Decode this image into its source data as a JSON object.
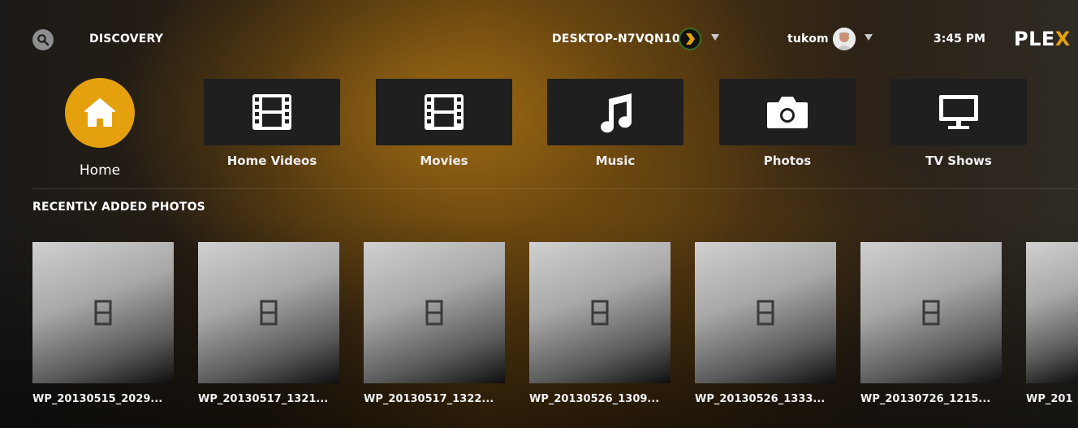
{
  "header": {
    "discovery_label": "DISCOVERY",
    "server_name": "DESKTOP-N7VQN10",
    "username": "tukom",
    "time": "3:45 PM",
    "logo_text": "PLE",
    "logo_accent": "X"
  },
  "nav": {
    "home_label": "Home",
    "libraries": [
      {
        "label": "Home Videos",
        "icon": "film-icon"
      },
      {
        "label": "Movies",
        "icon": "film-icon"
      },
      {
        "label": "Music",
        "icon": "music-note-icon"
      },
      {
        "label": "Photos",
        "icon": "camera-icon"
      },
      {
        "label": "TV Shows",
        "icon": "tv-icon"
      }
    ]
  },
  "recent": {
    "title": "RECENTLY ADDED PHOTOS",
    "items": [
      "WP_20130515_2029...",
      "WP_20130517_1321...",
      "WP_20130517_1322...",
      "WP_20130526_1309...",
      "WP_20130526_1333...",
      "WP_20130726_1215...",
      "WP_201"
    ]
  },
  "colors": {
    "accent": "#e5a00d",
    "tile": "#1f1f1f"
  }
}
